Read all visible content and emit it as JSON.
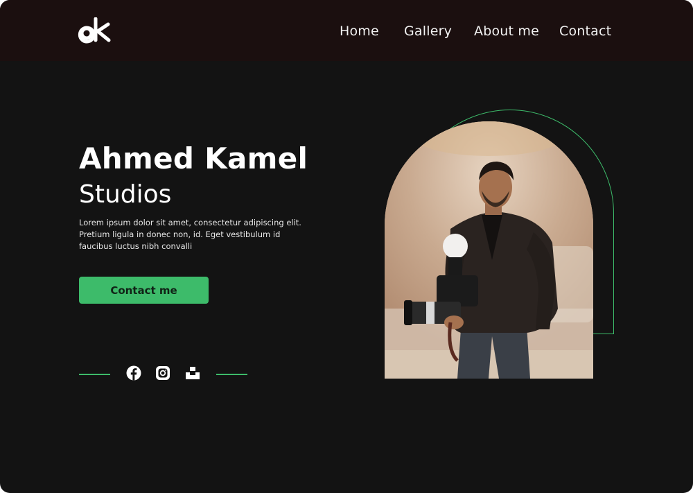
{
  "header": {
    "logo_text": "aK",
    "nav": {
      "home": "Home",
      "gallery": "Gallery",
      "about": "About me",
      "contact": "Contact"
    }
  },
  "hero": {
    "title": "Ahmed Kamel",
    "subtitle": "Studios",
    "description_lines": [
      "Lorem ipsum dolor sit amet, consectetur adipiscing elit.",
      "Pretium ligula in donec non, id. Eget vestibulum id",
      "faucibus luctus nibh convalli"
    ],
    "cta_label": "Contact me"
  },
  "social": {
    "icons": [
      "facebook-icon",
      "instagram-icon",
      "unsplash-icon"
    ]
  },
  "colors": {
    "accent": "#3dbb6a",
    "background": "#131313",
    "header": "#1b0f0f",
    "text": "#ffffff"
  }
}
